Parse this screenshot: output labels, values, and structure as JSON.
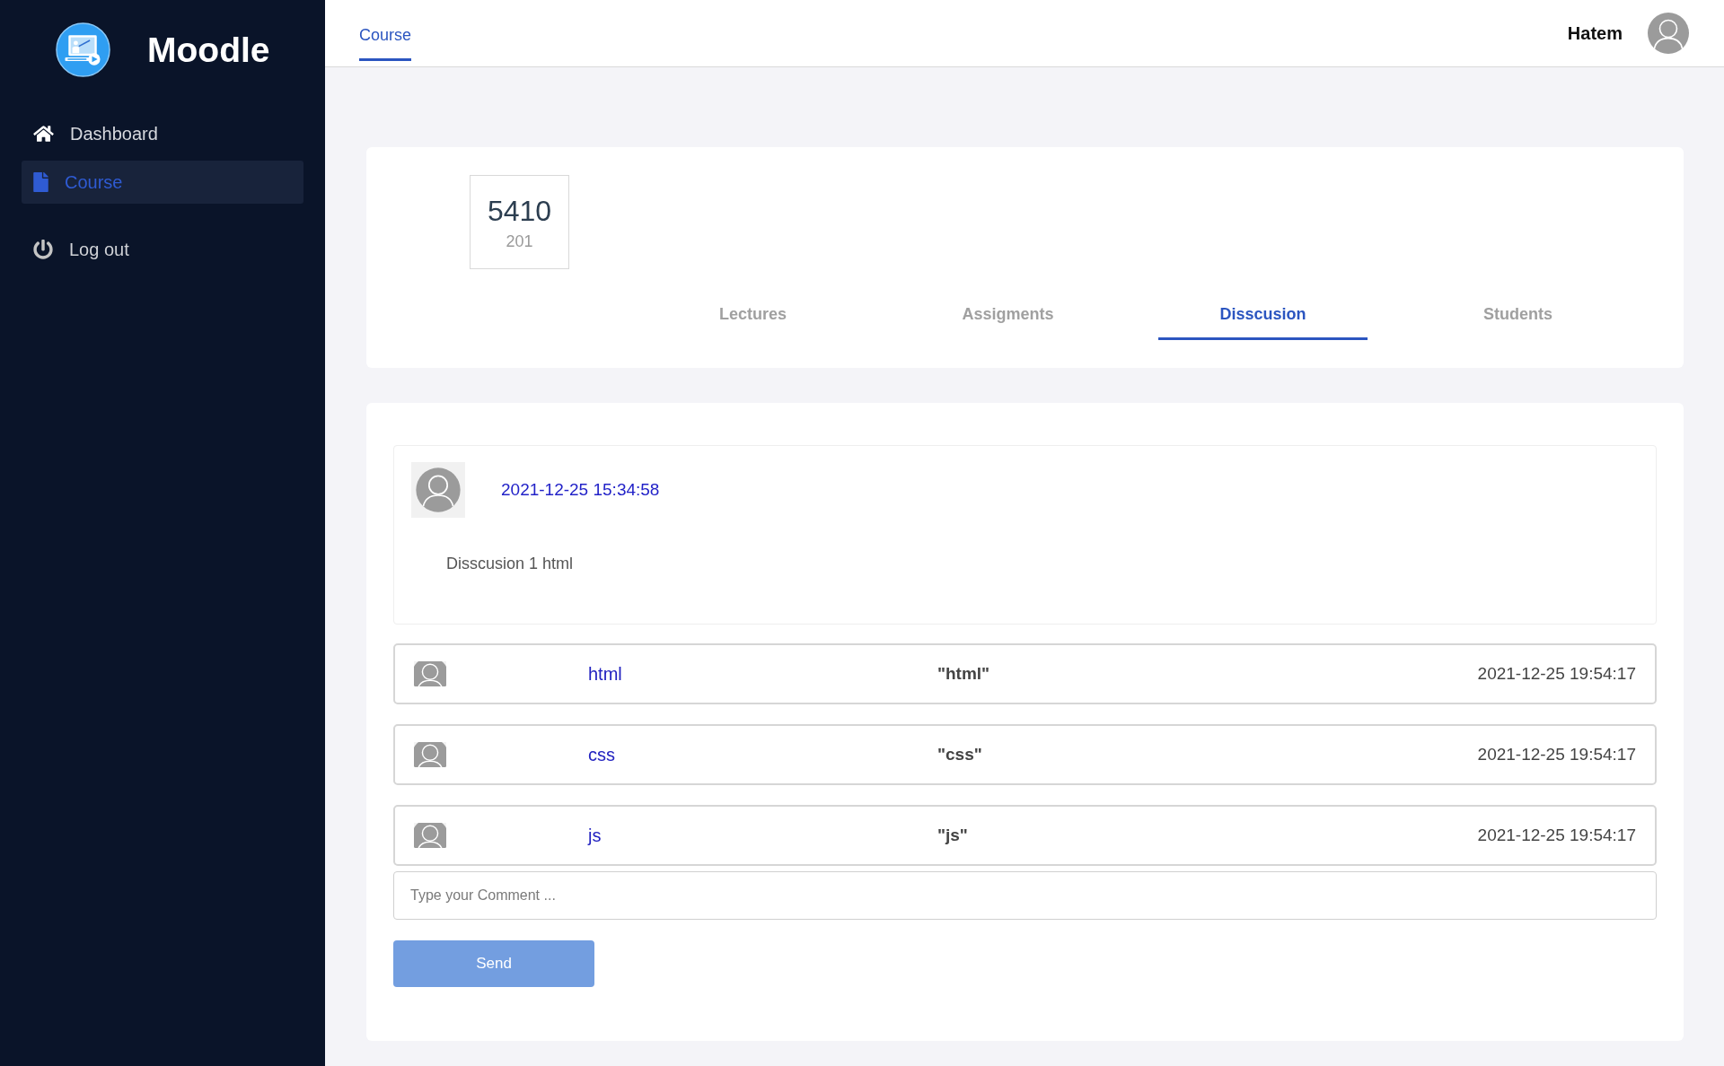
{
  "sidebar": {
    "brand": "Moodle",
    "items": [
      {
        "label": "Dashboard",
        "selected": false
      },
      {
        "label": "Course",
        "selected": true
      }
    ],
    "logout": "Log out"
  },
  "topbar": {
    "tabs": [
      {
        "label": "Course",
        "selected": true
      }
    ],
    "user_name": "Hatem"
  },
  "course": {
    "code": "5410",
    "section": "201",
    "tabs": [
      {
        "label": "Lectures",
        "selected": false
      },
      {
        "label": "Assigments",
        "selected": false
      },
      {
        "label": "Disscusion",
        "selected": true
      },
      {
        "label": "Students",
        "selected": false
      }
    ]
  },
  "discussion": {
    "post": {
      "date": "2021-12-25 15:34:58",
      "text": "Disscusion 1 html"
    },
    "comments": [
      {
        "author": "html",
        "text": "\"html\"",
        "date": "2021-12-25 19:54:17"
      },
      {
        "author": "css",
        "text": "\"css\"",
        "date": "2021-12-25 19:54:17"
      },
      {
        "author": "js",
        "text": "\"js\"",
        "date": "2021-12-25 19:54:17"
      }
    ],
    "comment_field": {
      "placeholder": "Type your Comment ..."
    },
    "send_button": "Send"
  }
}
